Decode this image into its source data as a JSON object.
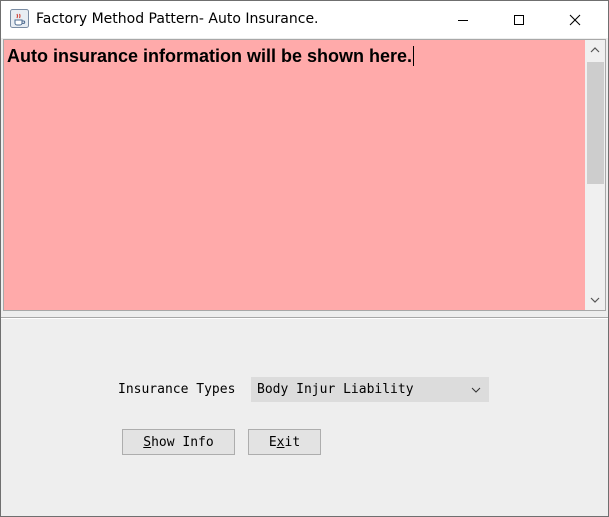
{
  "window": {
    "title": "Factory Method Pattern- Auto Insurance.",
    "icons": {
      "app": "java-cup-icon",
      "minimize": "minimize-icon",
      "maximize": "maximize-icon",
      "close": "close-icon"
    }
  },
  "text_area": {
    "content": "Auto insurance information will be shown here.",
    "background": "#ffaaaa"
  },
  "form": {
    "insurance_types_label": "Insurance Types",
    "insurance_types_selected": "Body Injur Liability"
  },
  "buttons": {
    "show_info": {
      "mnemonic": "S",
      "rest": "how Info"
    },
    "exit": {
      "first": "E",
      "mnemonic": "x",
      "rest": "it"
    }
  }
}
